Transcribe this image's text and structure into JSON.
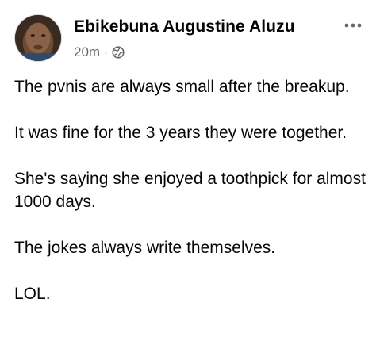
{
  "post": {
    "author": "Ebikebuna Augustine Aluzu",
    "timestamp": "20m",
    "separator": "·",
    "privacy_icon": "globe-icon",
    "more_icon": "more-options-icon",
    "paragraphs": [
      "The pvnis are always small after the breakup.",
      "It was fine for the 3 years they were together.",
      "She's saying she enjoyed a toothpick for almost 1000 days.",
      "The jokes always write themselves.",
      "LOL."
    ]
  },
  "colors": {
    "text": "#050505",
    "secondary": "#65676b",
    "background": "#ffffff"
  }
}
